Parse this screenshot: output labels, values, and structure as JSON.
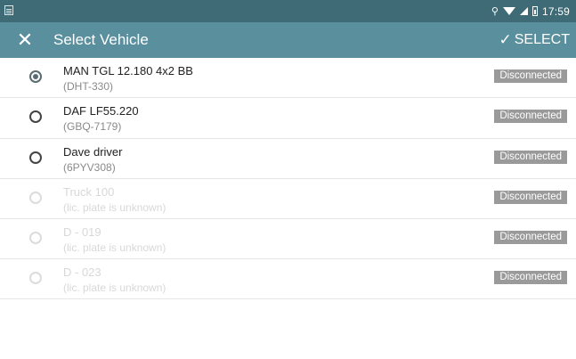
{
  "status_bar": {
    "time": "17:59"
  },
  "app_bar": {
    "title": "Select Vehicle",
    "select_label": "SELECT"
  },
  "vehicles": [
    {
      "name": "MAN TGL 12.180 4x2 BB",
      "plate": "(DHT-330)",
      "status": "Disconnected",
      "selected": true,
      "enabled": true
    },
    {
      "name": "DAF LF55.220",
      "plate": "(GBQ-7179)",
      "status": "Disconnected",
      "selected": false,
      "enabled": true
    },
    {
      "name": "Dave driver",
      "plate": "(6PYV308)",
      "status": "Disconnected",
      "selected": false,
      "enabled": true
    },
    {
      "name": "Truck 100",
      "plate": "(lic. plate is unknown)",
      "status": "Disconnected",
      "selected": false,
      "enabled": false
    },
    {
      "name": "D - 019",
      "plate": "(lic. plate is unknown)",
      "status": "Disconnected",
      "selected": false,
      "enabled": false
    },
    {
      "name": "D - 023",
      "plate": "(lic. plate is unknown)",
      "status": "Disconnected",
      "selected": false,
      "enabled": false
    }
  ],
  "colors": {
    "status_bar": "#3f6b76",
    "app_bar": "#5a8f9d",
    "badge": "#9a9a9a"
  }
}
